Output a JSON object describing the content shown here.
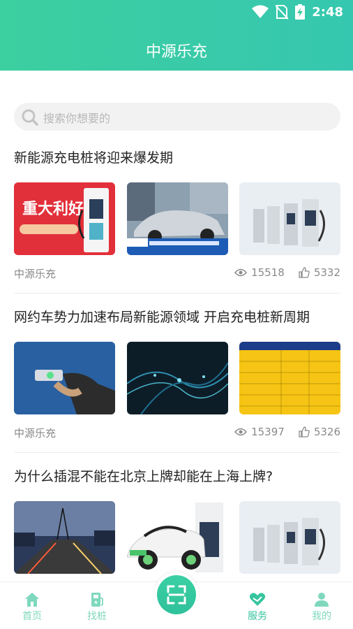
{
  "status_bar": {
    "time": "2:48"
  },
  "header": {
    "title": "中源乐充"
  },
  "search": {
    "placeholder": "搜索你想要的"
  },
  "articles": [
    {
      "title": "新能源充电桩将迎来爆发期",
      "thumb1_text": "重大利好",
      "source": "中源乐充",
      "views": "15518",
      "likes": "5332"
    },
    {
      "title": "网约车势力加速布局新能源领域 开启充电桩新周期",
      "source": "中源乐充",
      "views": "15397",
      "likes": "5326"
    },
    {
      "title": "为什么插混不能在北京上牌却能在上海上牌?"
    }
  ],
  "tabbar": {
    "items": [
      {
        "label": "首页"
      },
      {
        "label": "找桩"
      },
      {
        "label": "服务"
      },
      {
        "label": "我的"
      }
    ],
    "active": "服务"
  },
  "colors": {
    "brand": "#3ccf9f",
    "accent_text": "#36c49e",
    "tab_inactive": "#7fd8bd"
  }
}
